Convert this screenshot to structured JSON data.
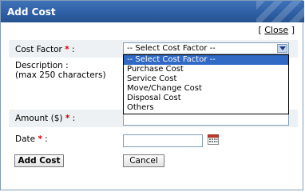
{
  "dialog": {
    "title": "Add Cost",
    "close_prefix": "[ ",
    "close_label": "Close",
    "close_suffix": " ]"
  },
  "form": {
    "cost_factor": {
      "label": "Cost Factor",
      "required_marker": "*",
      "colon": ":",
      "selected": "-- Select Cost Factor --",
      "options": [
        "-- Select Cost Factor --",
        "Purchase Cost",
        "Service Cost",
        "Move/Change Cost",
        "Disposal Cost",
        "Others"
      ]
    },
    "description": {
      "label": "Description :",
      "hint": "(max 250 characters)"
    },
    "amount": {
      "label": "Amount ($)",
      "required_marker": "*",
      "colon": ":"
    },
    "date": {
      "label": "Date",
      "required_marker": "*",
      "colon": ":",
      "value": ""
    },
    "buttons": {
      "add": "Add Cost",
      "cancel": "Cancel"
    }
  },
  "colors": {
    "title_bar": "#2e5ea3",
    "selected_option": "#316ac5",
    "required": "#d40000",
    "shaded_row": "#eef1f3"
  }
}
